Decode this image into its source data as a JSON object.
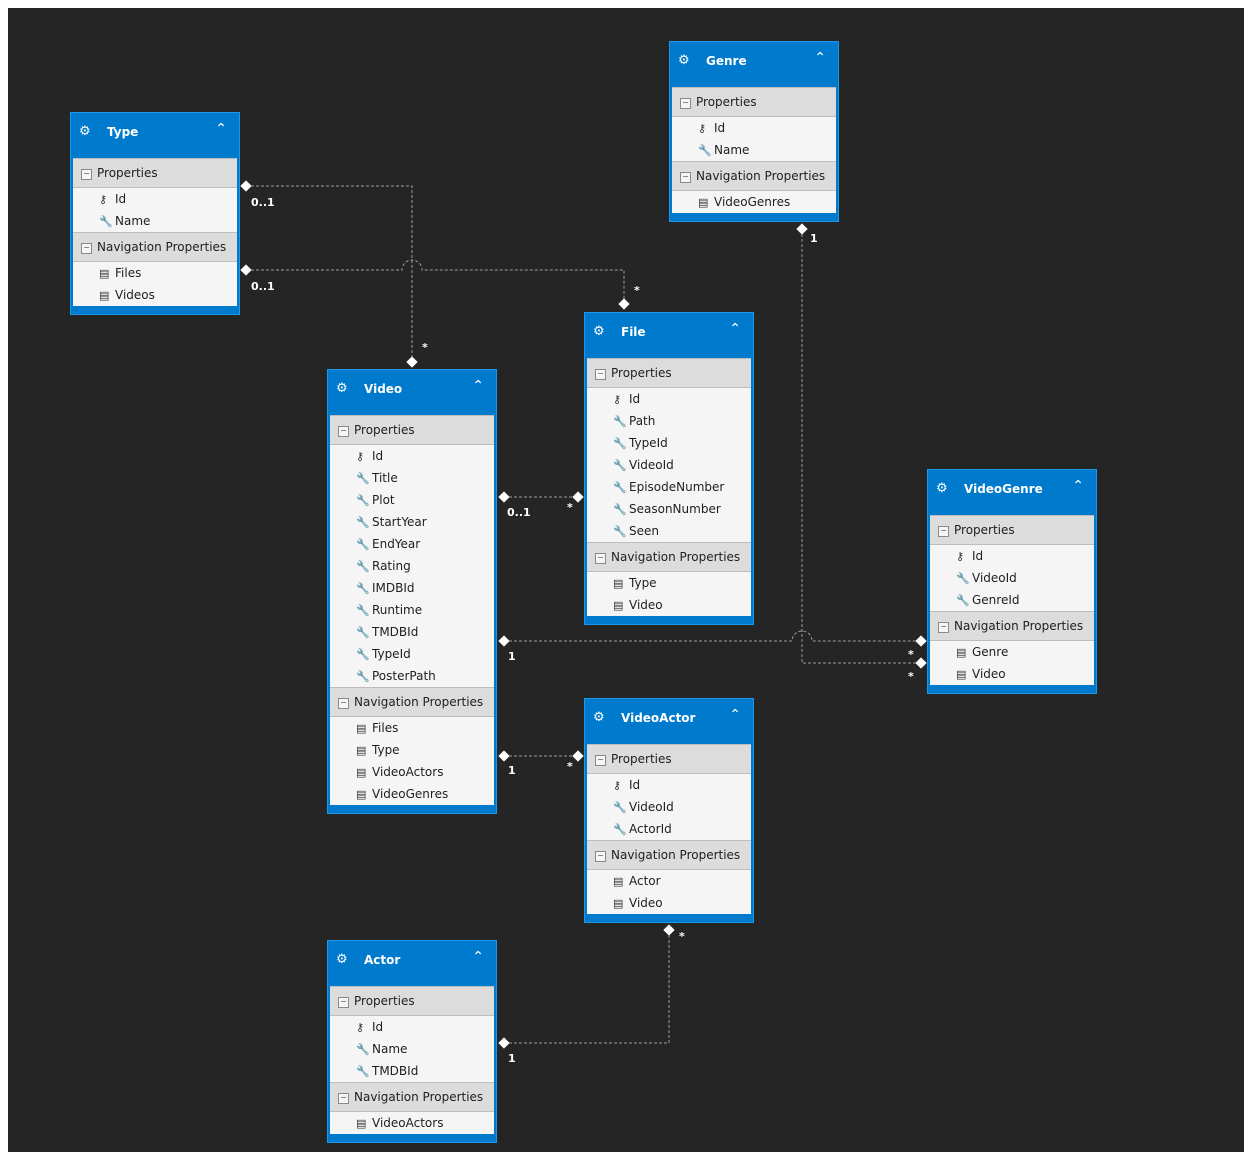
{
  "colors": {
    "canvas": "#252526",
    "header": "#007acc",
    "line": "#9a9a9a",
    "body": "#f5f5f5"
  },
  "icons": {
    "entity": "entity-icon",
    "collapse": "chevron-up-icon",
    "section": "collapse-toggle-icon",
    "key": "key-icon",
    "property": "wrench-icon",
    "navigation": "navigation-property-icon"
  },
  "section_labels": {
    "properties": "Properties",
    "navigation": "Navigation Properties"
  },
  "entities": [
    {
      "name": "Type",
      "properties": [
        "Id",
        "Name"
      ],
      "navigation": [
        "Files",
        "Videos"
      ]
    },
    {
      "name": "Genre",
      "properties": [
        "Id",
        "Name"
      ],
      "navigation": [
        "VideoGenres"
      ]
    },
    {
      "name": "File",
      "properties": [
        "Id",
        "Path",
        "TypeId",
        "VideoId",
        "EpisodeNumber",
        "SeasonNumber",
        "Seen"
      ],
      "navigation": [
        "Type",
        "Video"
      ]
    },
    {
      "name": "Video",
      "properties": [
        "Id",
        "Title",
        "Plot",
        "StartYear",
        "EndYear",
        "Rating",
        "IMDBId",
        "Runtime",
        "TMDBId",
        "TypeId",
        "PosterPath"
      ],
      "navigation": [
        "Files",
        "Type",
        "VideoActors",
        "VideoGenres"
      ]
    },
    {
      "name": "VideoGenre",
      "properties": [
        "Id",
        "VideoId",
        "GenreId"
      ],
      "navigation": [
        "Genre",
        "Video"
      ]
    },
    {
      "name": "VideoActor",
      "properties": [
        "Id",
        "VideoId",
        "ActorId"
      ],
      "navigation": [
        "Actor",
        "Video"
      ]
    },
    {
      "name": "Actor",
      "properties": [
        "Id",
        "Name",
        "TMDBId"
      ],
      "navigation": [
        "VideoActors"
      ]
    }
  ],
  "relationships": [
    {
      "from": "Type",
      "to": "Video",
      "from_mult": "0..1",
      "to_mult": "*"
    },
    {
      "from": "Type",
      "to": "File",
      "from_mult": "0..1",
      "to_mult": "*"
    },
    {
      "from": "Video",
      "to": "File",
      "from_mult": "0..1",
      "to_mult": "*"
    },
    {
      "from": "Video",
      "to": "VideoGenre",
      "from_mult": "1",
      "to_mult": "*"
    },
    {
      "from": "Genre",
      "to": "VideoGenre",
      "from_mult": "1",
      "to_mult": "*"
    },
    {
      "from": "Video",
      "to": "VideoActor",
      "from_mult": "1",
      "to_mult": "*"
    },
    {
      "from": "Actor",
      "to": "VideoActor",
      "from_mult": "1",
      "to_mult": "*"
    }
  ]
}
